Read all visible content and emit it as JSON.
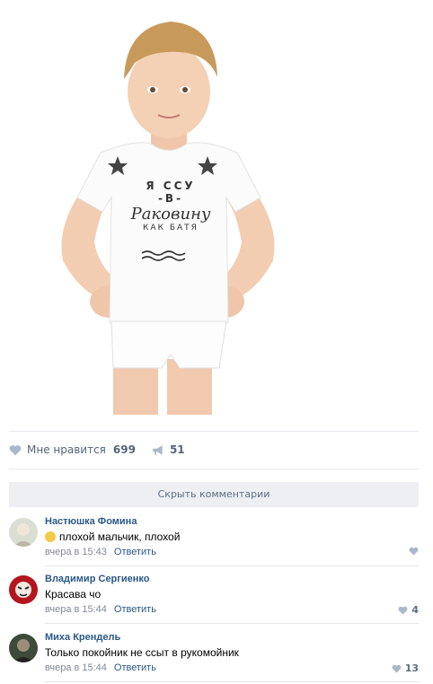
{
  "post": {
    "shirt_text": {
      "line1": "Я ССУ",
      "line2": "-В-",
      "line3": "Раковину",
      "line4": "КАК БАТЯ"
    },
    "actions": {
      "like_label": "Мне нравится",
      "like_count": "699",
      "share_count": "51"
    },
    "hide_comments_label": "Скрыть комментарии"
  },
  "comments": [
    {
      "author": "Настюшка Фомина",
      "text": "плохой мальчик, плохой",
      "emoji": "weary-face",
      "time": "вчера в 15:43",
      "reply": "Ответить",
      "likes": ""
    },
    {
      "author": "Владимир Сергиенко",
      "text": "Красава чо",
      "time": "вчера в 15:44",
      "reply": "Ответить",
      "likes": "4"
    },
    {
      "author": "Миха Крендель",
      "text": "Только покойник не ссыт в рукомойник",
      "time": "вчера в 15:44",
      "reply": "Ответить",
      "likes": "13"
    }
  ],
  "colors": {
    "link": "#2a5885",
    "muted": "#828a99",
    "icon": "#aab8c9",
    "hide_bg": "#edeff3"
  }
}
